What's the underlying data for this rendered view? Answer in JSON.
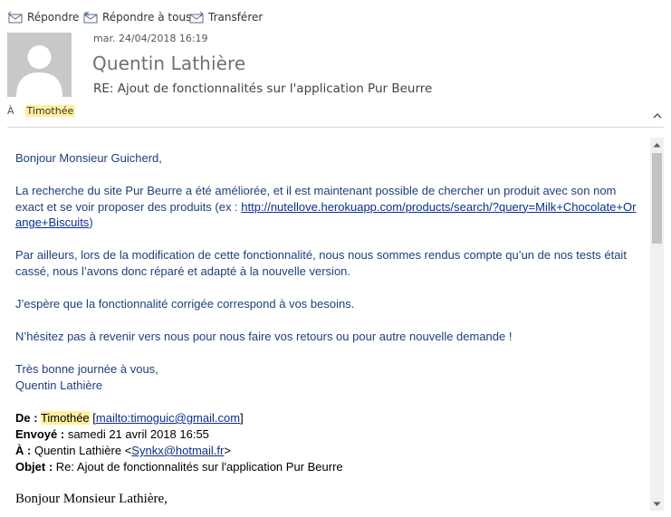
{
  "toolbar": {
    "reply_label": "Répondre",
    "reply_all_label": "Répondre à tous",
    "forward_label": "Transférer",
    "reply_icon": "reply-icon",
    "reply_all_icon": "reply-all-icon",
    "forward_icon": "forward-icon"
  },
  "header": {
    "date": "mar. 24/04/2018 16:19",
    "sender": "Quentin Lathière",
    "subject": "RE: Ajout de fonctionnalités sur l'application Pur Beurre",
    "to_label": "À",
    "to_name": "Timothée"
  },
  "body": {
    "greeting": "Bonjour Monsieur Guicherd,",
    "p1_text": "La recherche du site Pur Beurre a été améliorée, et il est maintenant possible de chercher un produit avec son nom exact et se voir proposer des produits (ex : ",
    "p1_link": "http://nutellove.herokuapp.com/products/search/?query=Milk+Chocolate+Orange+Biscuits",
    "p1_close": ")",
    "p2": "Par ailleurs, lors de la modification de cette fonctionnalité, nous nous sommes rendus compte qu’un de nos tests était cassé, nous l’avons donc réparé et adapté à la nouvelle version.",
    "p3": "J’espère que la fonctionnalité corrigée correspond à vos besoins.",
    "p4": "N’hésitez pas à revenir vers nous pour nous faire vos retours ou pour autre nouvelle demande !",
    "closing": "Très bonne journée à vous,",
    "signature": "Quentin Lathière"
  },
  "quoted": {
    "from_label": "De :",
    "from_name": "Timothée",
    "from_open": "[",
    "from_link": "mailto:timoguic@gmail.com",
    "from_close": "]",
    "sent_label": "Envoyé :",
    "sent_value": "samedi 21 avril 2018 16:55",
    "to_label": "À :",
    "to_value": "Quentin Lathière <",
    "to_link": "Synkx@hotmail.fr",
    "to_close": ">",
    "subject_label": "Objet :",
    "subject_value": "Re: Ajout de fonctionnalités sur l'application Pur Beurre",
    "greeting": "Bonjour Monsieur Lathière,"
  },
  "colors": {
    "body_text": "#1f3f7a",
    "link": "#0b2f8a",
    "highlight": "#fff0a0",
    "sender_gray": "#707070"
  }
}
